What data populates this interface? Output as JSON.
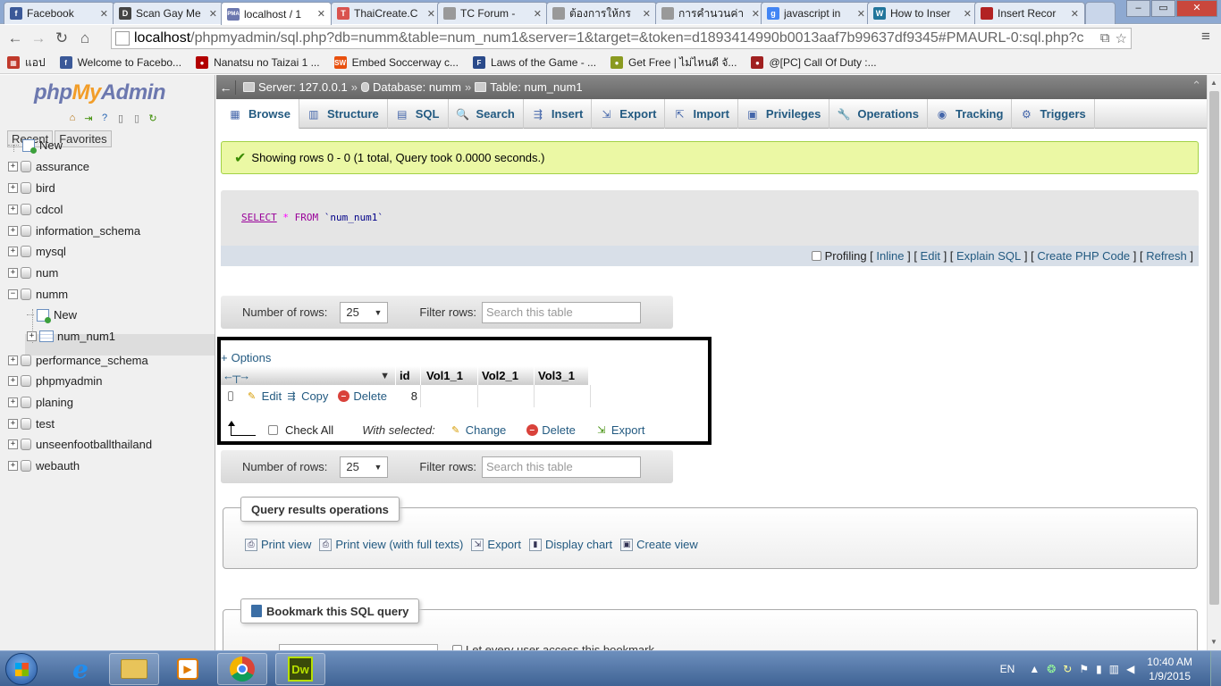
{
  "browser": {
    "tabs": [
      {
        "title": "Facebook",
        "favicon_color": "#3b5998",
        "favicon_text": "f"
      },
      {
        "title": "Scan Gay Me",
        "favicon_color": "#444444",
        "favicon_text": "D"
      },
      {
        "title": "localhost / 1",
        "favicon_color": "#6c78af",
        "favicon_text": "PMA",
        "active": true
      },
      {
        "title": "ThaiCreate.C",
        "favicon_color": "#d9534f",
        "favicon_text": "T"
      },
      {
        "title": "TC Forum - ",
        "favicon_color": "#999999",
        "favicon_text": ""
      },
      {
        "title": "ต้องการให้กร",
        "favicon_color": "#999999",
        "favicon_text": ""
      },
      {
        "title": "การคำนวนค่า",
        "favicon_color": "#999999",
        "favicon_text": ""
      },
      {
        "title": "javascript in",
        "favicon_color": "#4285f4",
        "favicon_text": "g"
      },
      {
        "title": "How to Inser",
        "favicon_color": "#21759b",
        "favicon_text": "W"
      },
      {
        "title": "Insert Recor",
        "favicon_color": "#b22222",
        "favicon_text": ""
      }
    ],
    "address_host": "localhost",
    "address_rest": "/phpmyadmin/sql.php?db=numm&table=num_num1&server=1&target=&token=d1893414990b0013aaf7b99637df9345#PMAURL-0:sql.php?c",
    "bookmarks": [
      {
        "label": "แอป",
        "color": "#c0392b",
        "text": "▦"
      },
      {
        "label": "Welcome to Facebo...",
        "color": "#3b5998",
        "text": "f"
      },
      {
        "label": "Nanatsu no Taizai 1 ...",
        "color": "#b20000",
        "text": "●"
      },
      {
        "label": "Embed Soccerway c...",
        "color": "#e8500e",
        "text": "SW"
      },
      {
        "label": "Laws of the Game - ...",
        "color": "#2a4a8a",
        "text": "F"
      },
      {
        "label": "Get Free | ไม่ไหนดี จั...",
        "color": "#8a9a20",
        "text": "●"
      },
      {
        "label": "@[PC] Call Of Duty :...",
        "color": "#a02020",
        "text": "●"
      }
    ]
  },
  "pma": {
    "logo": {
      "php": "php",
      "my": "My",
      "admin": "Admin"
    },
    "left_tabs": [
      "Recent",
      "Favorites"
    ],
    "tree": [
      {
        "label": "New",
        "kind": "new",
        "level": 0
      },
      {
        "label": "assurance",
        "kind": "db",
        "level": 0
      },
      {
        "label": "bird",
        "kind": "db",
        "level": 0
      },
      {
        "label": "cdcol",
        "kind": "db",
        "level": 0
      },
      {
        "label": "information_schema",
        "kind": "db",
        "level": 0
      },
      {
        "label": "mysql",
        "kind": "db",
        "level": 0
      },
      {
        "label": "num",
        "kind": "db",
        "level": 0
      },
      {
        "label": "numm",
        "kind": "db",
        "level": 0,
        "expanded": true
      },
      {
        "label": "New",
        "kind": "new",
        "level": 1
      },
      {
        "label": "num_num1",
        "kind": "table",
        "level": 1,
        "selected": true
      },
      {
        "label": "performance_schema",
        "kind": "db",
        "level": 0
      },
      {
        "label": "phpmyadmin",
        "kind": "db",
        "level": 0
      },
      {
        "label": "planing",
        "kind": "db",
        "level": 0
      },
      {
        "label": "test",
        "kind": "db",
        "level": 0
      },
      {
        "label": "unseenfootballthailand",
        "kind": "db",
        "level": 0
      },
      {
        "label": "webauth",
        "kind": "db",
        "level": 0
      }
    ],
    "breadcrumb": {
      "server": "Server: 127.0.0.1",
      "database": "Database: numm",
      "table": "Table: num_num1",
      "sep": "»"
    },
    "menu_tabs": [
      {
        "label": "Browse",
        "icon": "▦",
        "active": true
      },
      {
        "label": "Structure",
        "icon": "▥"
      },
      {
        "label": "SQL",
        "icon": "▤"
      },
      {
        "label": "Search",
        "icon": "🔍"
      },
      {
        "label": "Insert",
        "icon": "⇶"
      },
      {
        "label": "Export",
        "icon": "⇲"
      },
      {
        "label": "Import",
        "icon": "⇱"
      },
      {
        "label": "Privileges",
        "icon": "▣"
      },
      {
        "label": "Operations",
        "icon": "🔧"
      },
      {
        "label": "Tracking",
        "icon": "◉"
      },
      {
        "label": "Triggers",
        "icon": "⚙"
      }
    ],
    "success_message": "Showing rows 0 - 0 (1 total, Query took 0.0000 seconds.)",
    "sql_query": {
      "select": "SELECT",
      "star": "*",
      "from": "FROM",
      "table": "`num_num1`"
    },
    "sql_links": {
      "profiling": "Profiling",
      "inline": "Inline",
      "edit": "Edit",
      "explain": "Explain SQL",
      "php": "Create PHP Code",
      "refresh": "Refresh"
    },
    "nav": {
      "rows_label": "Number of rows:",
      "rows_value": "25",
      "filter_label": "Filter rows:",
      "filter_placeholder": "Search this table"
    },
    "results": {
      "options_label": "Options",
      "columns": [
        "id",
        "Vol1_1",
        "Vol2_1",
        "Vol3_1"
      ],
      "rows": [
        {
          "id": "8",
          "vol1": "",
          "vol2": "",
          "vol3": ""
        }
      ],
      "row_actions": {
        "edit": "Edit",
        "copy": "Copy",
        "delete": "Delete"
      },
      "bulk": {
        "check_all": "Check All",
        "with_selected": "With selected:",
        "change": "Change",
        "delete": "Delete",
        "export": "Export"
      }
    },
    "query_ops": {
      "legend": "Query results operations",
      "items": [
        "Print view",
        "Print view (with full texts)",
        "Export",
        "Display chart",
        "Create view"
      ]
    },
    "bookmark": {
      "legend": "Bookmark this SQL query",
      "share_label": "Let every user access this bookmark"
    }
  },
  "taskbar": {
    "lang": "EN",
    "time": "10:40 AM",
    "date": "1/9/2015"
  }
}
